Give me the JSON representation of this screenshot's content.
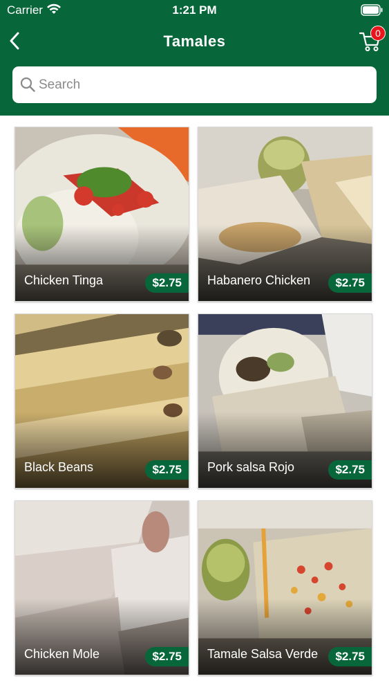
{
  "status_bar": {
    "carrier": "Carrier",
    "time": "1:21 PM"
  },
  "nav": {
    "title": "Tamales",
    "cart_count": "0"
  },
  "search": {
    "placeholder": "Search",
    "value": ""
  },
  "colors": {
    "brand_green": "#08673a",
    "badge_red": "#e8161c"
  },
  "items": [
    {
      "name": "Chicken Tinga",
      "price": "$2.75"
    },
    {
      "name": "Habanero Chicken",
      "price": "$2.75"
    },
    {
      "name": "Black Beans",
      "price": "$2.75"
    },
    {
      "name": "Pork salsa Rojo",
      "price": "$2.75"
    },
    {
      "name": "Chicken Mole",
      "price": "$2.75"
    },
    {
      "name": "Tamale Salsa Verde",
      "price": "$2.75"
    }
  ]
}
